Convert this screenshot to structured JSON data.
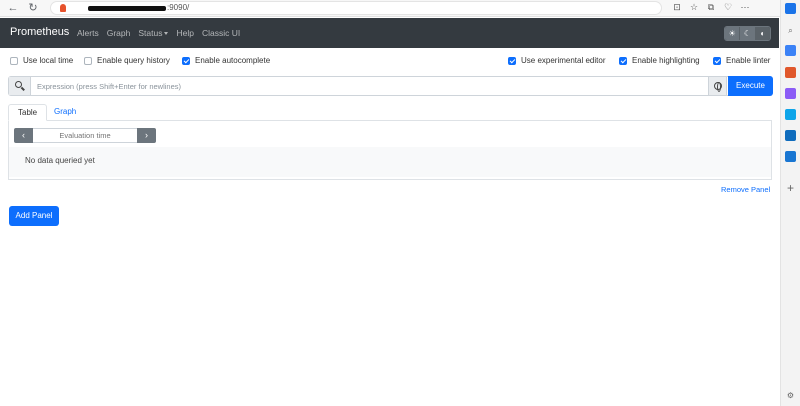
{
  "browser": {
    "back": "←",
    "refresh": "↻",
    "url_suffix": ":9090/",
    "toolbar_icons": [
      "⊡",
      "☆",
      "⧉",
      "♡",
      "⋯",
      "✦"
    ]
  },
  "navbar": {
    "brand": "Prometheus",
    "links": [
      "Alerts",
      "Graph",
      "Status",
      "Help",
      "Classic UI"
    ],
    "theme_icons": [
      "☀",
      "☾",
      "◐"
    ]
  },
  "options": {
    "local_time": "Use local time",
    "query_history": "Enable query history",
    "autocomplete": "Enable autocomplete",
    "experimental_editor": "Use experimental editor",
    "highlighting": "Enable highlighting",
    "linter": "Enable linter"
  },
  "expression": {
    "placeholder": "Expression (press Shift+Enter for newlines)",
    "execute_label": "Execute"
  },
  "tabs": [
    "Table",
    "Graph"
  ],
  "panel": {
    "prev": "‹",
    "next": "›",
    "eval_placeholder": "Evaluation time",
    "no_data": "No data queried yet",
    "remove_label": "Remove Panel"
  },
  "add_panel_label": "Add Panel",
  "colors": {
    "navbar": "#343a40",
    "primary": "#0d6efd",
    "secondary": "#6c757d"
  }
}
